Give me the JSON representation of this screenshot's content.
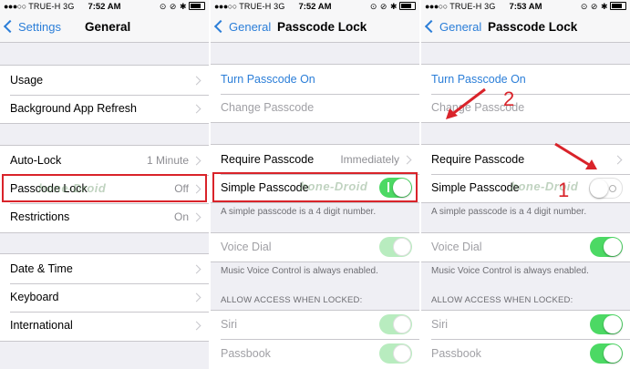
{
  "status_bar": {
    "carrier": "TRUE-H",
    "network": "3G",
    "icons": "⊙ ⊘ ✱"
  },
  "panel1": {
    "time": "7:52 AM",
    "nav": {
      "back": "Settings",
      "title": "General"
    },
    "rows": [
      {
        "label": "Usage",
        "value": ""
      },
      {
        "label": "Background App Refresh",
        "value": ""
      },
      {
        "label": "Auto-Lock",
        "value": "1 Minute"
      },
      {
        "label": "Passcode Lock",
        "value": "Off"
      },
      {
        "label": "Restrictions",
        "value": "On"
      },
      {
        "label": "Date & Time",
        "value": ""
      },
      {
        "label": "Keyboard",
        "value": ""
      },
      {
        "label": "International",
        "value": ""
      }
    ]
  },
  "panel2": {
    "time": "7:52 AM",
    "nav": {
      "back": "General",
      "title": "Passcode Lock"
    },
    "turn_on": "Turn Passcode On",
    "change": "Change Passcode",
    "require": {
      "label": "Require Passcode",
      "value": "Immediately"
    },
    "simple": {
      "label": "Simple Passcode",
      "state": "on"
    },
    "simple_note": "A simple passcode is a 4 digit number.",
    "voice_dial": "Voice Dial",
    "voice_note": "Music Voice Control is always enabled.",
    "allow_header": "ALLOW ACCESS WHEN LOCKED:",
    "siri": "Siri",
    "passbook": "Passbook"
  },
  "panel3": {
    "time": "7:53 AM",
    "nav": {
      "back": "General",
      "title": "Passcode Lock"
    },
    "turn_on": "Turn Passcode On",
    "change": "Change Passcode",
    "require": {
      "label": "Require Passcode",
      "value": ""
    },
    "simple": {
      "label": "Simple Passcode",
      "state": "off"
    },
    "simple_note": "A simple passcode is a 4 digit number.",
    "voice_dial": "Voice Dial",
    "voice_note": "Music Voice Control is always enabled.",
    "allow_header": "ALLOW ACCESS WHEN LOCKED:",
    "siri": "Siri",
    "passbook": "Passbook"
  },
  "annotations": {
    "num1": "1",
    "num2": "2"
  },
  "watermark": "hone-Droid",
  "colors": {
    "accent": "#2b7ed8",
    "toggle_on": "#4cd964",
    "highlight": "#d9232a"
  }
}
